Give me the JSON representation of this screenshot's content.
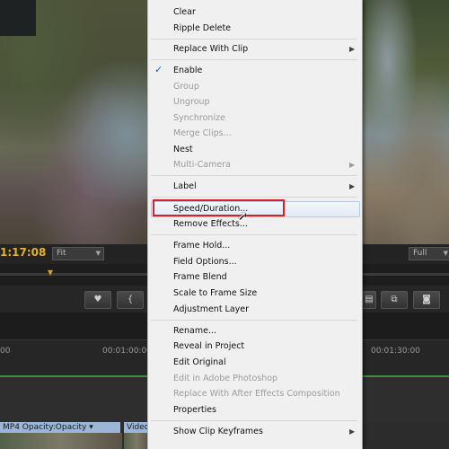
{
  "program_monitor": {
    "timecode": "1:17:08",
    "fit_select": "Fit",
    "quality_select": "Full"
  },
  "timeline": {
    "ruler_labels": [
      "00",
      "00:01:00:00",
      "00:01:30:00"
    ],
    "clip_label_left": "MP4  Opacity:Opacity ▾",
    "clip_label_right": "Video"
  },
  "context_menu": {
    "items": [
      {
        "label": "Clear",
        "enabled": true
      },
      {
        "label": "Ripple Delete",
        "enabled": true
      },
      {
        "label": "Replace With Clip",
        "enabled": true,
        "submenu": true
      },
      {
        "label": "Enable",
        "enabled": true,
        "checked": true
      },
      {
        "label": "Group",
        "enabled": false
      },
      {
        "label": "Ungroup",
        "enabled": false
      },
      {
        "label": "Synchronize",
        "enabled": false
      },
      {
        "label": "Merge Clips...",
        "enabled": false
      },
      {
        "label": "Nest",
        "enabled": true
      },
      {
        "label": "Multi-Camera",
        "enabled": false,
        "submenu": true
      },
      {
        "label": "Label",
        "enabled": true,
        "submenu": true
      },
      {
        "label": "Speed/Duration...",
        "enabled": true,
        "highlighted": true
      },
      {
        "label": "Remove Effects...",
        "enabled": true
      },
      {
        "label": "Frame Hold...",
        "enabled": true
      },
      {
        "label": "Field Options...",
        "enabled": true
      },
      {
        "label": "Frame Blend",
        "enabled": true
      },
      {
        "label": "Scale to Frame Size",
        "enabled": true
      },
      {
        "label": "Adjustment Layer",
        "enabled": true
      },
      {
        "label": "Rename...",
        "enabled": true
      },
      {
        "label": "Reveal in Project",
        "enabled": true
      },
      {
        "label": "Edit Original",
        "enabled": true
      },
      {
        "label": "Edit in Adobe Photoshop",
        "enabled": false
      },
      {
        "label": "Replace With After Effects Composition",
        "enabled": false
      },
      {
        "label": "Properties",
        "enabled": true
      },
      {
        "label": "Show Clip Keyframes",
        "enabled": true,
        "submenu": true
      }
    ]
  },
  "colors": {
    "timecode": "#e6b422",
    "highlight_border": "#d8202a",
    "clip_label_bg": "#9bb6d6",
    "track_green": "#3e8e3e"
  }
}
